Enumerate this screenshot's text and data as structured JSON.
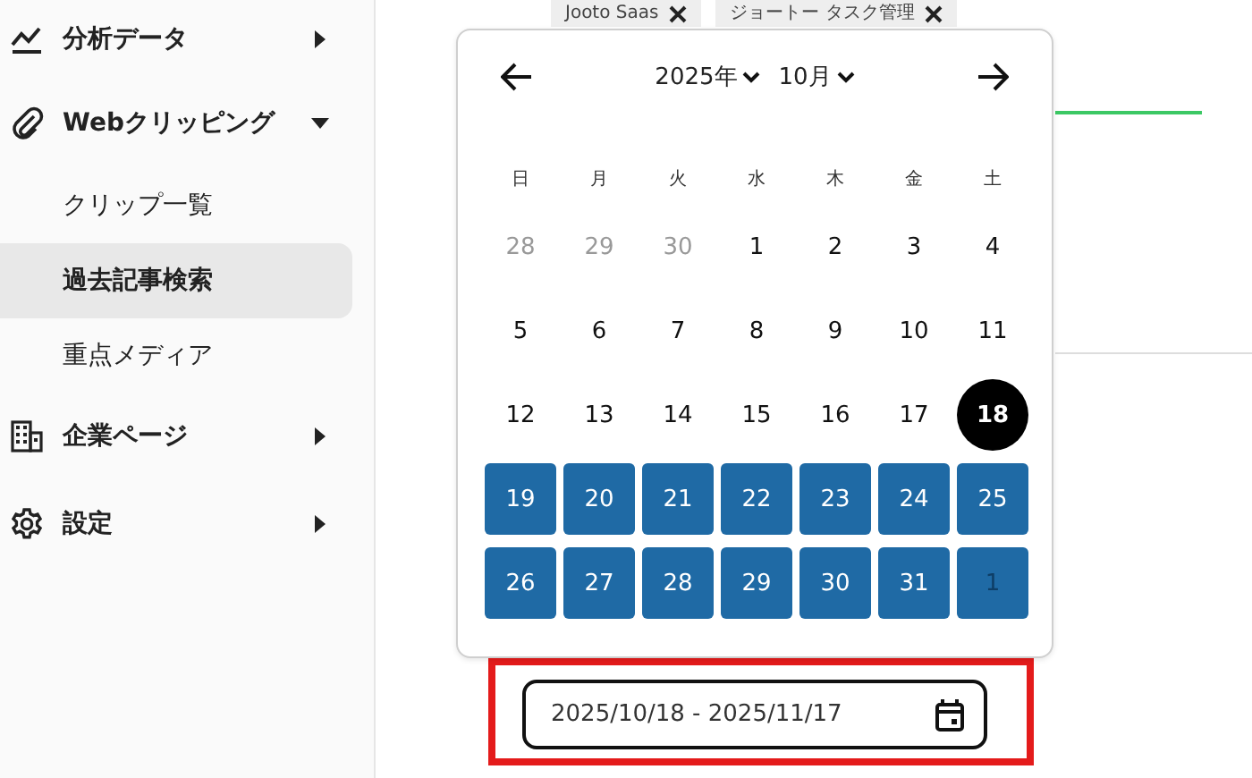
{
  "sidebar": {
    "items": [
      {
        "label": "分析データ",
        "expanded": false
      },
      {
        "label": "Webクリッピング",
        "expanded": true,
        "children": [
          {
            "label": "クリップ一覧",
            "selected": false
          },
          {
            "label": "過去記事検索",
            "selected": true
          },
          {
            "label": "重点メディア",
            "selected": false
          }
        ]
      },
      {
        "label": "企業ページ",
        "expanded": false
      },
      {
        "label": "設定",
        "expanded": false
      }
    ]
  },
  "tags": [
    {
      "label": "Jooto Saas"
    },
    {
      "label": "ジョートー タスク管理"
    }
  ],
  "calendar": {
    "year": "2025年",
    "month": "10月",
    "weekdays": [
      "日",
      "月",
      "火",
      "水",
      "木",
      "金",
      "土"
    ],
    "days": [
      {
        "label": "28",
        "other_month": true,
        "kind": "plain"
      },
      {
        "label": "29",
        "other_month": true,
        "kind": "plain"
      },
      {
        "label": "30",
        "other_month": true,
        "kind": "plain"
      },
      {
        "label": "1",
        "other_month": false,
        "kind": "plain"
      },
      {
        "label": "2",
        "other_month": false,
        "kind": "plain"
      },
      {
        "label": "3",
        "other_month": false,
        "kind": "plain"
      },
      {
        "label": "4",
        "other_month": false,
        "kind": "plain"
      },
      {
        "label": "5",
        "other_month": false,
        "kind": "plain"
      },
      {
        "label": "6",
        "other_month": false,
        "kind": "plain"
      },
      {
        "label": "7",
        "other_month": false,
        "kind": "plain"
      },
      {
        "label": "8",
        "other_month": false,
        "kind": "plain"
      },
      {
        "label": "9",
        "other_month": false,
        "kind": "plain"
      },
      {
        "label": "10",
        "other_month": false,
        "kind": "plain"
      },
      {
        "label": "11",
        "other_month": false,
        "kind": "plain"
      },
      {
        "label": "12",
        "other_month": false,
        "kind": "plain"
      },
      {
        "label": "13",
        "other_month": false,
        "kind": "plain"
      },
      {
        "label": "14",
        "other_month": false,
        "kind": "plain"
      },
      {
        "label": "15",
        "other_month": false,
        "kind": "plain"
      },
      {
        "label": "16",
        "other_month": false,
        "kind": "plain"
      },
      {
        "label": "17",
        "other_month": false,
        "kind": "plain"
      },
      {
        "label": "18",
        "other_month": false,
        "kind": "start"
      },
      {
        "label": "19",
        "other_month": false,
        "kind": "range"
      },
      {
        "label": "20",
        "other_month": false,
        "kind": "range"
      },
      {
        "label": "21",
        "other_month": false,
        "kind": "range"
      },
      {
        "label": "22",
        "other_month": false,
        "kind": "range"
      },
      {
        "label": "23",
        "other_month": false,
        "kind": "range"
      },
      {
        "label": "24",
        "other_month": false,
        "kind": "range"
      },
      {
        "label": "25",
        "other_month": false,
        "kind": "range"
      },
      {
        "label": "26",
        "other_month": false,
        "kind": "range"
      },
      {
        "label": "27",
        "other_month": false,
        "kind": "range"
      },
      {
        "label": "28",
        "other_month": false,
        "kind": "range"
      },
      {
        "label": "29",
        "other_month": false,
        "kind": "range"
      },
      {
        "label": "30",
        "other_month": false,
        "kind": "range"
      },
      {
        "label": "31",
        "other_month": false,
        "kind": "range"
      },
      {
        "label": "1",
        "other_month": true,
        "kind": "range"
      }
    ]
  },
  "date_field": {
    "value": "2025/10/18 - 2025/11/17",
    "highlighted": true
  }
}
